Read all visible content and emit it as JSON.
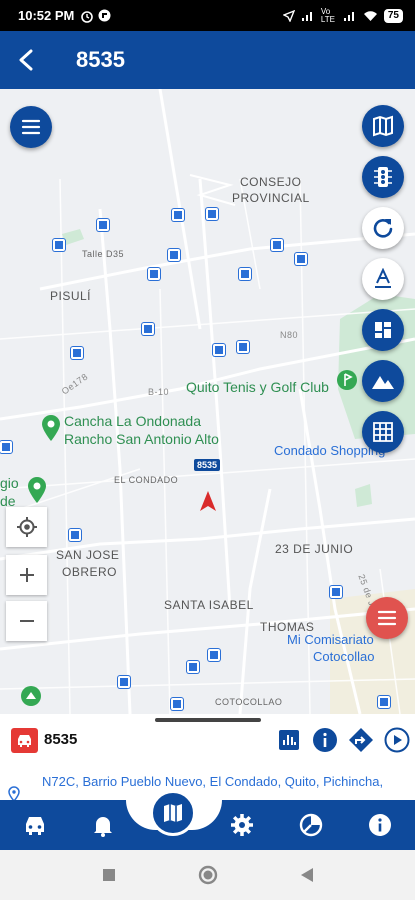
{
  "status_bar": {
    "time": "10:52 PM",
    "battery": "75",
    "network": "Vo LTE"
  },
  "app_bar": {
    "title": "8535"
  },
  "map": {
    "labels": {
      "consejo": "CONSEJO",
      "provincial": "PROVINCIAL",
      "pisuli": "PISULÍ",
      "talle": "Talle D35",
      "quito_tenis": "Quito Tenis y Golf Club",
      "cancha": "Cancha La Ondonada",
      "rancho": "Rancho San Antonio Alto",
      "condado_shopping": "Condado Shopping",
      "el_condado": "EL CONDADO",
      "san_jose": "SAN JOSE",
      "obrero": "OBRERO",
      "junio": "23 DE JUNIO",
      "santa_isabel": "SANTA ISABEL",
      "thomas": "THOMAS",
      "comisariato": "Mi Comisariato",
      "cotocollao": "Cotocollao",
      "cotocollao_small": "COTOCOLLAO",
      "gio": "gio",
      "de": "de",
      "n80": "N80",
      "b10": "B-10",
      "oe178": "Oe178",
      "de_junio_rd": "25 de Junio"
    },
    "vehicle_label": "8535"
  },
  "sheet": {
    "unit_name": "8535",
    "address": "N72C, Barrio Pueblo Nuevo, El Condado, Quito, Pichincha,"
  },
  "icons": {
    "menu": "menu-icon",
    "map_type": "map-icon",
    "traffic": "traffic-light-icon",
    "refresh": "refresh-icon",
    "labels": "text-a-icon",
    "satellite": "satellite-icon",
    "terrain": "terrain-icon",
    "grid": "grid-icon",
    "locate": "locate-icon"
  },
  "colors": {
    "primary": "#0e4a9c",
    "accent_red": "#e53935",
    "link_blue": "#2a6fd6",
    "map_bg": "#eef0f3"
  }
}
